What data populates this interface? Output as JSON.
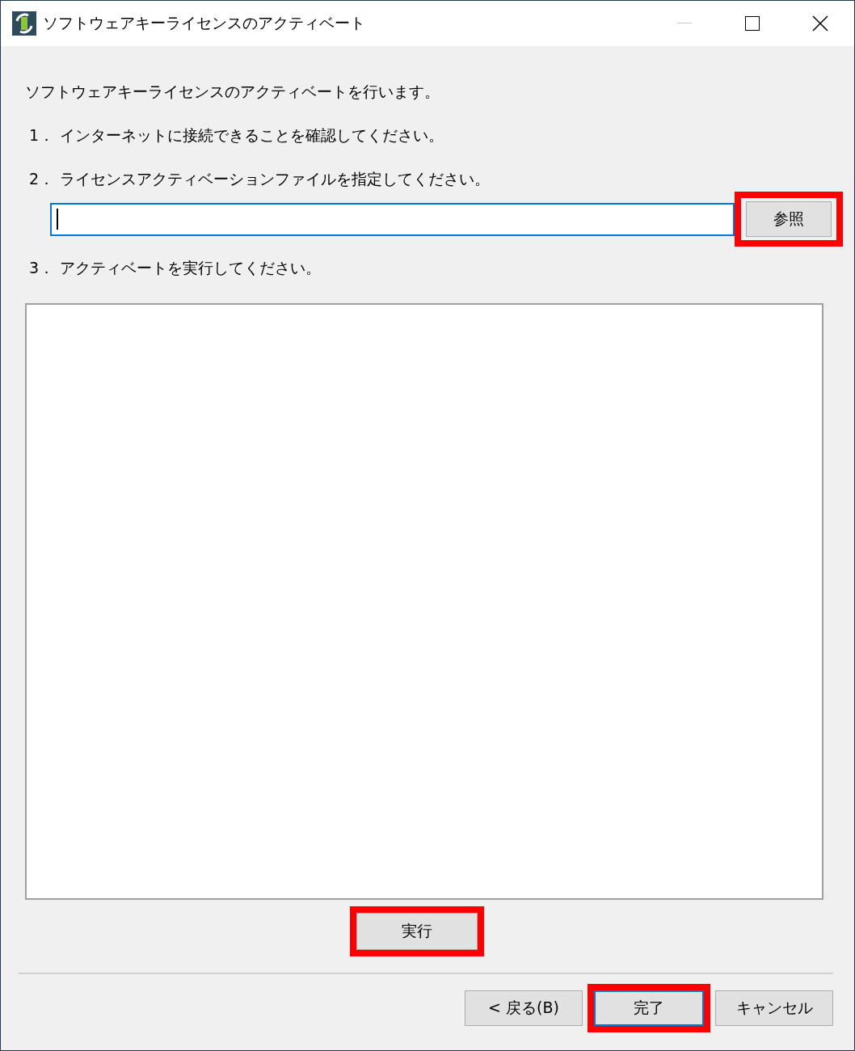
{
  "window": {
    "title": "ソフトウェアキーライセンスのアクティベート",
    "minimize_disabled": true
  },
  "intro": "ソフトウェアキーライセンスのアクティベートを行います。",
  "steps": [
    {
      "number": "1．",
      "text": "インターネットに接続できることを確認してください。"
    },
    {
      "number": "2．",
      "text": "ライセンスアクティベーションファイルを指定してください。"
    },
    {
      "number": "3．",
      "text": "アクティベートを実行してください。"
    }
  ],
  "file_field": {
    "focused": true
  },
  "browse_button": {
    "label": "参照",
    "highlighted": true
  },
  "execute_button": {
    "label": "実行",
    "highlighted": true
  },
  "footer_buttons": [
    {
      "label": "< 戻る(B)",
      "highlighted": false,
      "focused": false
    },
    {
      "label": "完了",
      "highlighted": true,
      "focused": true
    },
    {
      "label": "キャンセル",
      "highlighted": false,
      "focused": false
    }
  ]
}
